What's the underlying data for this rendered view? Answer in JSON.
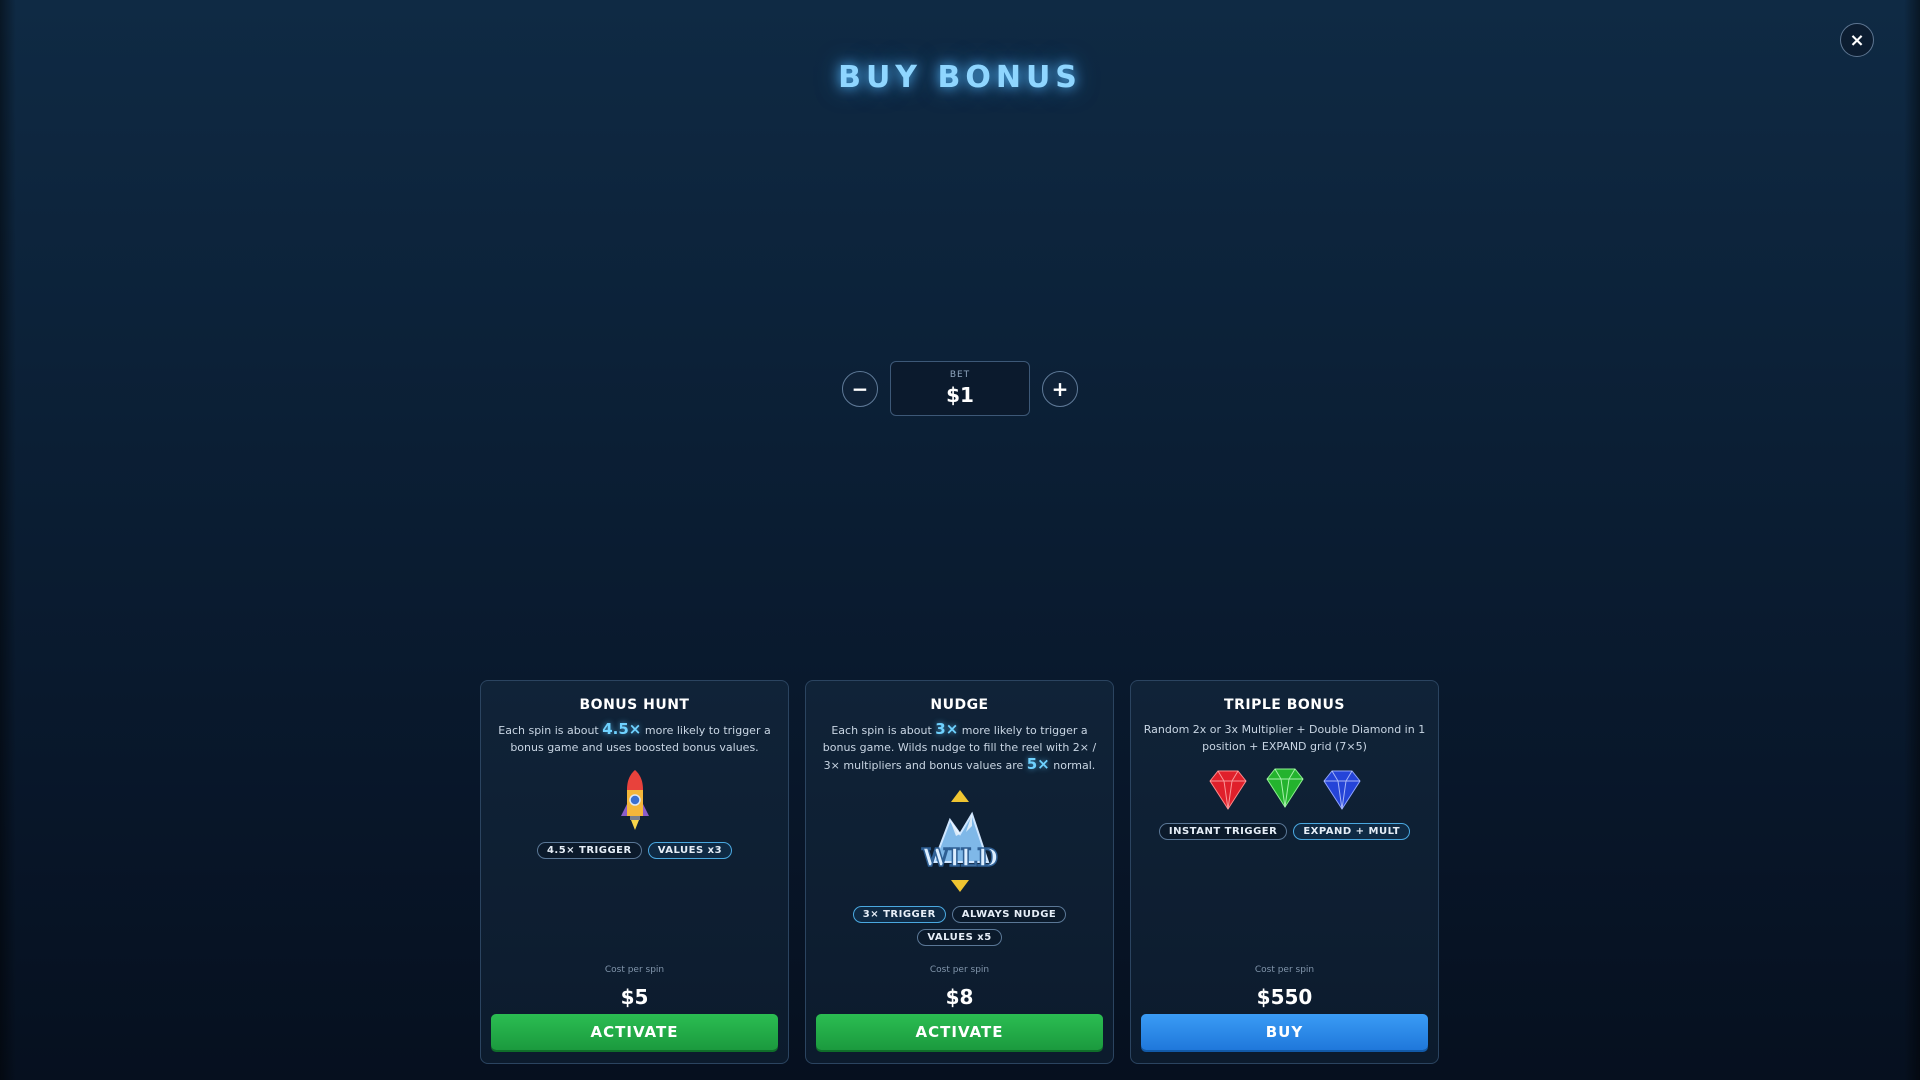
{
  "header": {
    "title": "BUY BONUS",
    "close_icon": "×"
  },
  "bet": {
    "label": "BET",
    "value": "$1",
    "decrease_icon": "−",
    "increase_icon": "+"
  },
  "cards": [
    {
      "title": "BONUS HUNT",
      "desc_pre": "Each spin is about ",
      "desc_hl1": "4.5×",
      "desc_post": " more likely to trigger a bonus game and uses boosted bonus values.",
      "art_icon": "rocket-icon",
      "tags": [
        "4.5× TRIGGER",
        "VALUES x3"
      ],
      "cost_label": "Cost per spin",
      "cost": "$5",
      "button": "ACTIVATE",
      "button_color": "#1fa847"
    },
    {
      "title": "NUDGE",
      "desc_pre": "Each spin is about ",
      "desc_hl1": "3×",
      "desc_mid": " more likely to trigger a bonus game. Wilds nudge to fill the reel with 2× / 3× multipliers and bonus values are ",
      "desc_hl2": "5×",
      "desc_post": " normal.",
      "art_icon": "wild-symbol-icon",
      "art_text": "WILD",
      "tags": [
        "3× TRIGGER",
        "ALWAYS NUDGE",
        "VALUES x5"
      ],
      "cost_label": "Cost per spin",
      "cost": "$8",
      "button": "ACTIVATE",
      "button_color": "#1fa847"
    },
    {
      "title": "TRIPLE BONUS",
      "desc": "Random 2x or 3x Multiplier + Double Diamond in 1 position + EXPAND grid (7×5)",
      "art_icon": "gems-icon",
      "gem_colors": [
        "#e0202b",
        "#24b32e",
        "#2544d8"
      ],
      "tags": [
        "INSTANT TRIGGER",
        "EXPAND + MULT"
      ],
      "cost_label": "Cost per spin",
      "cost": "$550",
      "button": "BUY",
      "button_color": "#2a8ae8"
    }
  ]
}
